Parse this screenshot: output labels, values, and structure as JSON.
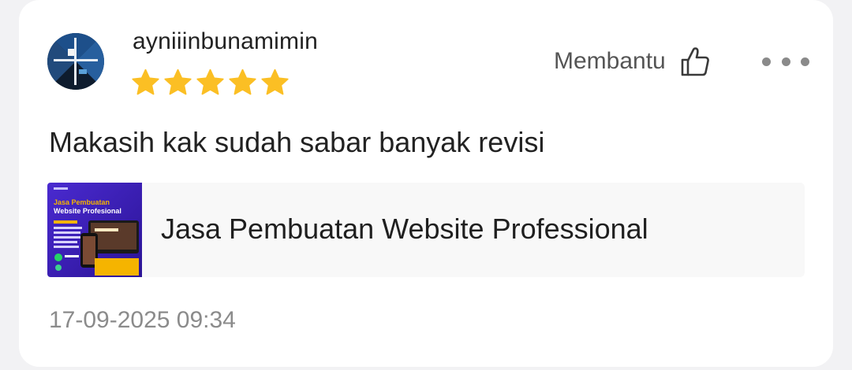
{
  "review": {
    "username": "ayniiinbunamimin",
    "rating": 5,
    "text": "Makasih kak sudah sabar banyak revisi",
    "timestamp": "17-09-2025 09:34"
  },
  "actions": {
    "helpful_label": "Membantu"
  },
  "product": {
    "title": "Jasa Pembuatan Website Professional",
    "thumbnail_heading": "Jasa Pembuatan Website Profesional"
  },
  "colors": {
    "star": "#fbbf24",
    "thumbnail_bg": "#3b1fb8",
    "thumbnail_accent": "#f5b400"
  },
  "icons": {
    "helpful": "thumbs-up-icon",
    "more": "more-horizontal-icon",
    "rating": "star-icon"
  }
}
